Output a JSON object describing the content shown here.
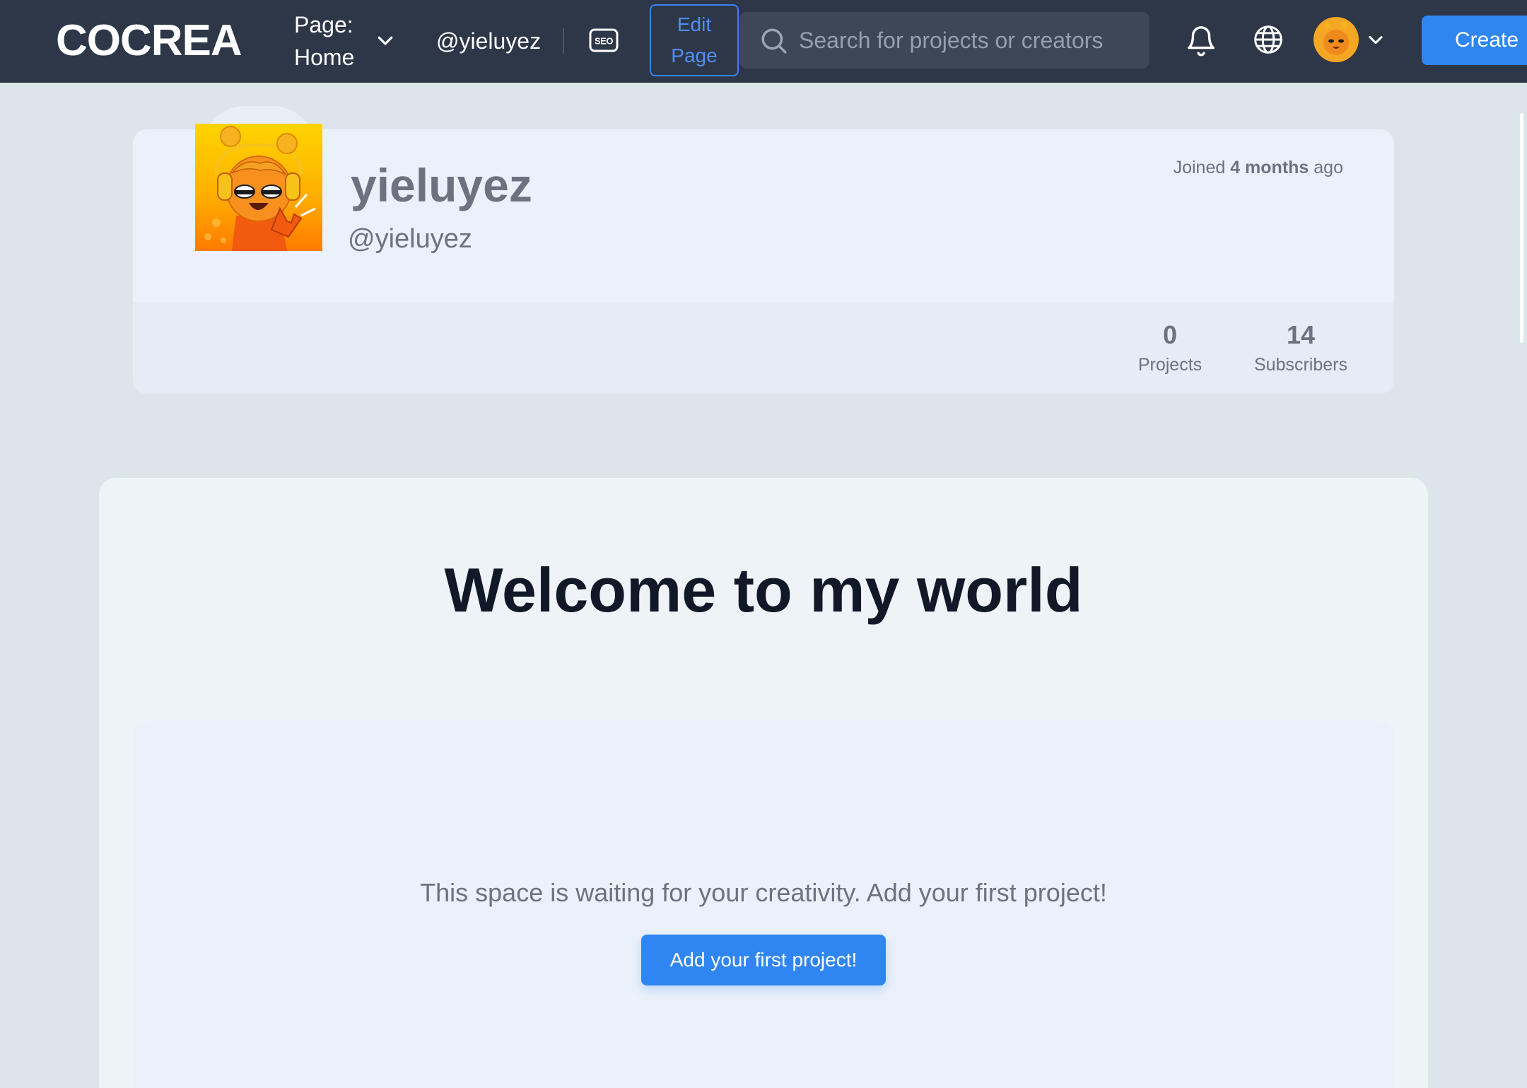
{
  "navbar": {
    "logo": "COCREA",
    "page_label": "Page:",
    "page_value": "Home",
    "handle": "@yieluyez",
    "seo_icon": "seo-icon",
    "edit_label_1": "Edit",
    "edit_label_2": "Page",
    "search_placeholder": "Search for projects or creators",
    "create_label": "Create"
  },
  "profile": {
    "display_name": "yieluyez",
    "handle": "@yieluyez",
    "joined_prefix": "Joined",
    "joined_value": "4 months",
    "joined_suffix": "ago",
    "stats": [
      {
        "value": "0",
        "label": "Projects"
      },
      {
        "value": "14",
        "label": "Subscribers"
      }
    ]
  },
  "main": {
    "heading": "Welcome to my world",
    "empty_message": "This space is waiting for your creativity. Add your first project!",
    "add_button": "Add your first project!"
  },
  "colors": {
    "navbar_bg": "#2d3748",
    "accent": "#2f86f2",
    "page_bg": "#dce6ea"
  }
}
